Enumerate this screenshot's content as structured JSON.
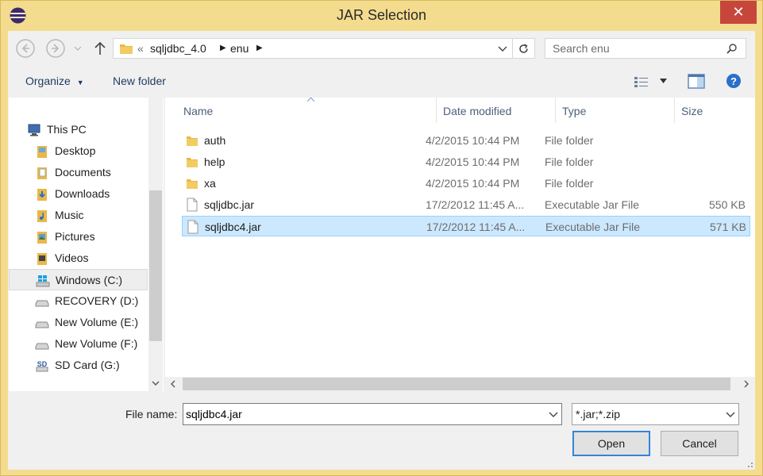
{
  "window": {
    "title": "JAR Selection"
  },
  "address_bar": {
    "overflow": "«",
    "segments": [
      "sqljdbc_4.0",
      "enu"
    ]
  },
  "search": {
    "placeholder": "Search enu"
  },
  "toolbar": {
    "organize_label": "Organize",
    "new_folder_label": "New folder"
  },
  "nav_pane": {
    "items": [
      {
        "label": "This PC",
        "icon": "computer-icon"
      },
      {
        "label": "Desktop",
        "icon": "folder-icon"
      },
      {
        "label": "Documents",
        "icon": "documents-icon"
      },
      {
        "label": "Downloads",
        "icon": "downloads-icon"
      },
      {
        "label": "Music",
        "icon": "music-icon"
      },
      {
        "label": "Pictures",
        "icon": "pictures-icon"
      },
      {
        "label": "Videos",
        "icon": "videos-icon"
      },
      {
        "label": "Windows (C:)",
        "icon": "windows-drive-icon",
        "selected": true
      },
      {
        "label": "RECOVERY (D:)",
        "icon": "drive-icon"
      },
      {
        "label": "New Volume (E:)",
        "icon": "drive-icon"
      },
      {
        "label": "New Volume (F:)",
        "icon": "drive-icon"
      },
      {
        "label": "SD Card (G:)",
        "icon": "sd-card-icon"
      }
    ]
  },
  "file_list": {
    "columns": [
      "Name",
      "Date modified",
      "Type",
      "Size"
    ],
    "rows": [
      {
        "name": "auth",
        "date": "4/2/2015 10:44 PM",
        "type": "File folder",
        "size": "",
        "icon": "folder-icon"
      },
      {
        "name": "help",
        "date": "4/2/2015 10:44 PM",
        "type": "File folder",
        "size": "",
        "icon": "folder-icon"
      },
      {
        "name": "xa",
        "date": "4/2/2015 10:44 PM",
        "type": "File folder",
        "size": "",
        "icon": "folder-icon"
      },
      {
        "name": "sqljdbc.jar",
        "date": "17/2/2012 11:45 A...",
        "type": "Executable Jar File",
        "size": "550 KB",
        "icon": "file-icon"
      },
      {
        "name": "sqljdbc4.jar",
        "date": "17/2/2012 11:45 A...",
        "type": "Executable Jar File",
        "size": "571 KB",
        "icon": "file-icon",
        "selected": true
      }
    ]
  },
  "footer": {
    "file_name_label": "File name:",
    "file_name_value": "sqljdbc4.jar",
    "filter_value": "*.jar;*.zip",
    "open_label": "Open",
    "cancel_label": "Cancel"
  },
  "colors": {
    "title_bar": "#f4dc8e",
    "close_button": "#c7463c",
    "selection": "#cce8ff",
    "folder": "#e8b84a"
  }
}
